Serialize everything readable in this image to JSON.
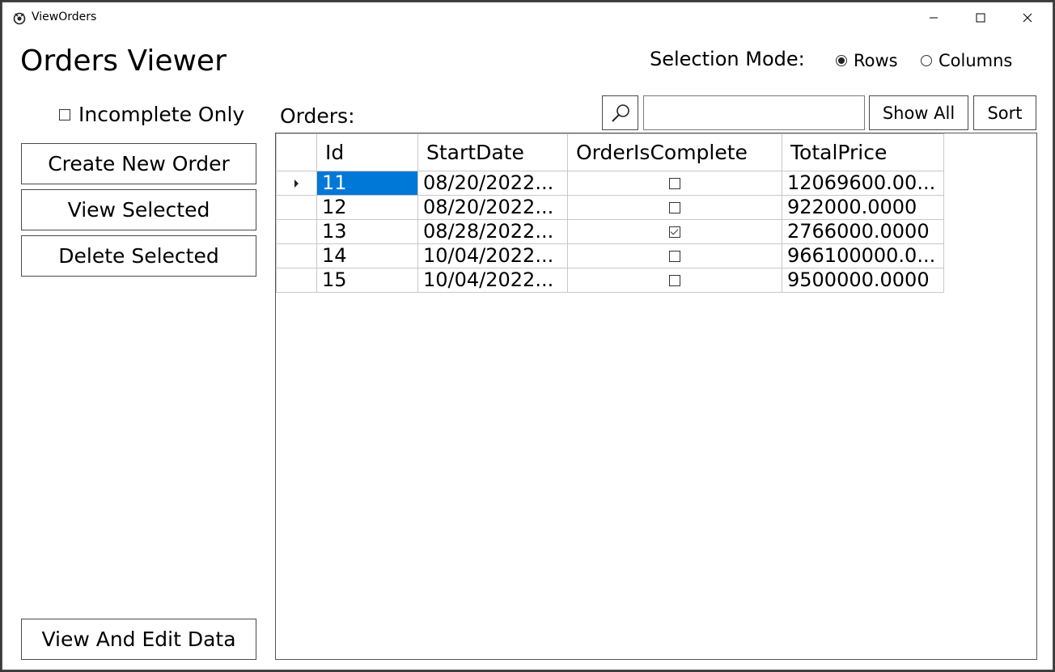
{
  "window": {
    "title": "ViewOrders"
  },
  "heading": "Orders Viewer",
  "selection_mode": {
    "label": "Selection Mode:",
    "options": [
      {
        "label": "Rows",
        "selected": true
      },
      {
        "label": "Columns",
        "selected": false
      }
    ]
  },
  "filter": {
    "incomplete_only_label": "Incomplete Only",
    "checked": false
  },
  "actions": {
    "create": "Create New Order",
    "view": "View Selected",
    "delete": "Delete Selected",
    "view_edit": "View And Edit Data"
  },
  "orders_label": "Orders:",
  "search": {
    "value": ""
  },
  "show_all": "Show All",
  "sort": "Sort",
  "grid": {
    "columns": [
      "Id",
      "StartDate",
      "OrderIsComplete",
      "TotalPrice"
    ],
    "rows": [
      {
        "id": "11",
        "start": "08/20/2022...",
        "complete": false,
        "price": "12069600.00...",
        "current": true
      },
      {
        "id": "12",
        "start": "08/20/2022...",
        "complete": false,
        "price": "922000.0000",
        "current": false
      },
      {
        "id": "13",
        "start": "08/28/2022...",
        "complete": true,
        "price": "2766000.0000",
        "current": false
      },
      {
        "id": "14",
        "start": "10/04/2022...",
        "complete": false,
        "price": "966100000.0...",
        "current": false
      },
      {
        "id": "15",
        "start": "10/04/2022...",
        "complete": false,
        "price": "9500000.0000",
        "current": false
      }
    ]
  },
  "colors": {
    "selection": "#0078d7"
  }
}
